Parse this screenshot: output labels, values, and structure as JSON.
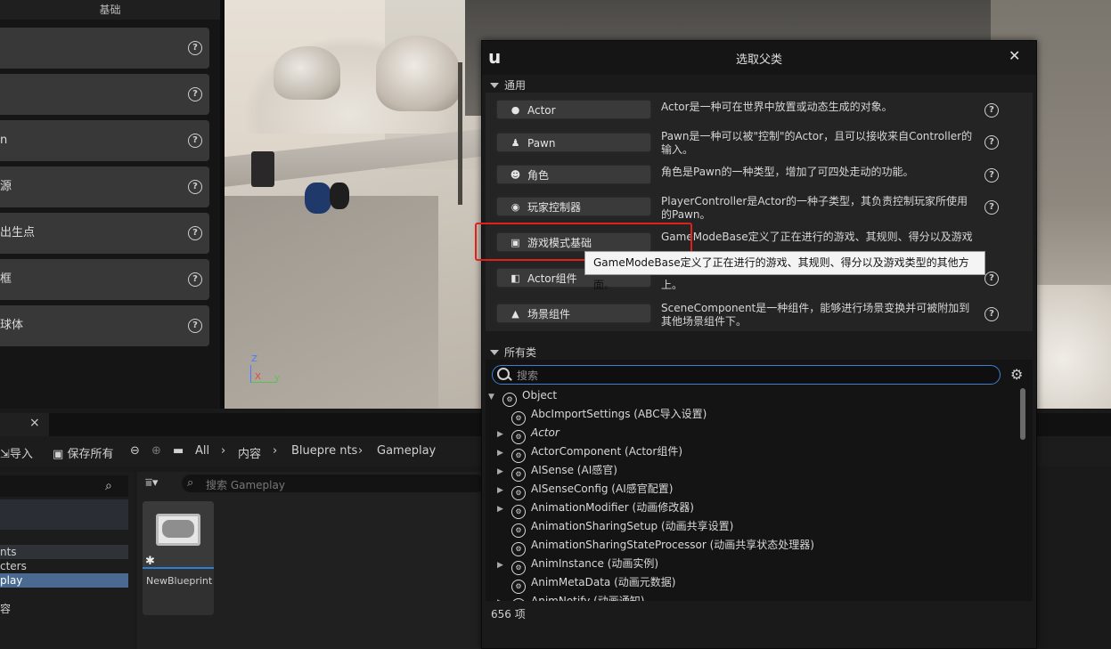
{
  "place_panel": {
    "header": "基础",
    "items": [
      {
        "label": ""
      },
      {
        "label": ""
      },
      {
        "label": "n"
      },
      {
        "label": "源"
      },
      {
        "label": "出生点"
      },
      {
        "label": "框"
      },
      {
        "label": "球体"
      }
    ]
  },
  "viewport": {
    "axis_z": "Z",
    "axis_x": "X",
    "axis_y": "Y"
  },
  "content_browser": {
    "tab_close": "×",
    "import_label": "导入",
    "save_all_label": "保存所有",
    "breadcrumb": [
      "All",
      "内容",
      "Bluepre nts",
      "Gameplay"
    ],
    "filter_placeholder": "搜索 Gameplay",
    "tree": [
      "nts",
      "cters",
      "play",
      "容"
    ],
    "asset_name": "NewBlueprint"
  },
  "dialog": {
    "title": "选取父类",
    "close": "✕",
    "common_section": "通用",
    "all_section": "所有类",
    "common_classes": [
      {
        "name": "Actor",
        "icon": "actor-icon",
        "desc": "Actor是一种可在世界中放置或动态生成的对象。"
      },
      {
        "name": "Pawn",
        "icon": "pawn-icon",
        "desc": "Pawn是一种可以被\"控制\"的Actor，且可以接收来自Controller的输入。"
      },
      {
        "name": "角色",
        "icon": "character-icon",
        "desc": "角色是Pawn的一种类型，增加了可四处走动的功能。"
      },
      {
        "name": "玩家控制器",
        "icon": "gamepad-icon",
        "desc": "PlayerController是Actor的一种子类型，其负责控制玩家所使用的Pawn。"
      },
      {
        "name": "游戏模式基础",
        "icon": "game-mode-icon",
        "desc": "GameModeBase定义了正在进行的游戏、其规则、得分以及游戏类型的其他方面。"
      },
      {
        "name": "Actor组件",
        "icon": "component-icon",
        "desc": "上。"
      },
      {
        "name": "场景组件",
        "icon": "scene-component-icon",
        "desc": "SceneComponent是一种组件，能够进行场景变换并可被附加到其他场景组件下。"
      }
    ],
    "tooltip": "GameModeBase定义了正在进行的游戏、其规则、得分以及游戏类型的其他方面。",
    "search_placeholder": "搜索",
    "class_tree": [
      {
        "name": "Object",
        "expandable": true,
        "expanded": true,
        "indent": 0
      },
      {
        "name": "AbcImportSettings (ABC导入设置)",
        "expandable": false,
        "indent": 1
      },
      {
        "name": "Actor",
        "expandable": true,
        "indent": 1
      },
      {
        "name": "ActorComponent (Actor组件)",
        "expandable": true,
        "indent": 1
      },
      {
        "name": "AISense (AI感官)",
        "expandable": true,
        "indent": 1
      },
      {
        "name": "AISenseConfig (AI感官配置)",
        "expandable": true,
        "indent": 1
      },
      {
        "name": "AnimationModifier (动画修改器)",
        "expandable": true,
        "indent": 1
      },
      {
        "name": "AnimationSharingSetup (动画共享设置)",
        "expandable": false,
        "indent": 1
      },
      {
        "name": "AnimationSharingStateProcessor (动画共享状态处理器)",
        "expandable": false,
        "indent": 1
      },
      {
        "name": "AnimInstance (动画实例)",
        "expandable": true,
        "indent": 1
      },
      {
        "name": "AnimMetaData (动画元数据)",
        "expandable": false,
        "indent": 1
      },
      {
        "name": "AnimNotify (动画通知)",
        "expandable": true,
        "indent": 1
      }
    ],
    "count": "656 项"
  }
}
